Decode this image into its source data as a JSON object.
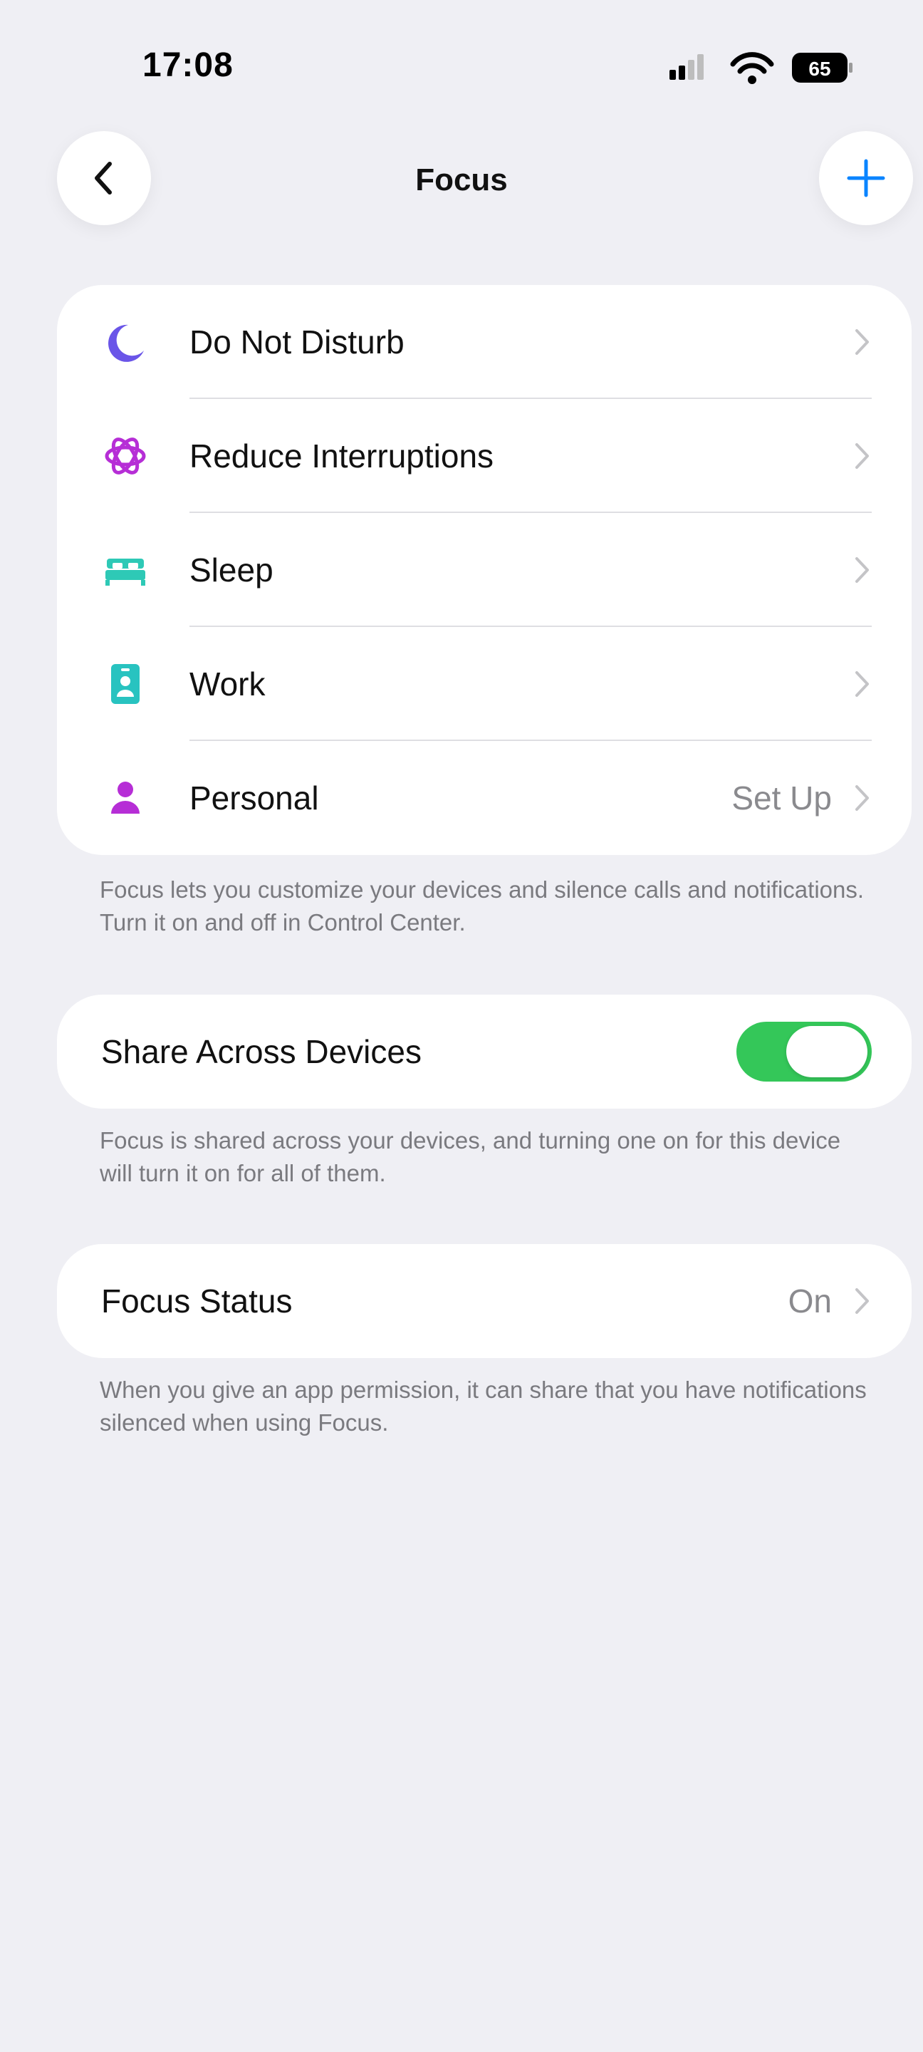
{
  "status_bar": {
    "time": "17:08",
    "battery_level": "65"
  },
  "nav": {
    "title": "Focus",
    "back_icon": "chevron-left-icon",
    "add_icon": "plus-icon"
  },
  "focus_modes": [
    {
      "label": "Do Not Disturb",
      "value": "",
      "icon": "moon-icon",
      "color": "#6a55e8"
    },
    {
      "label": "Reduce Interruptions",
      "value": "",
      "icon": "flower-icon",
      "color": "#b62ed6"
    },
    {
      "label": "Sleep",
      "value": "",
      "icon": "bed-icon",
      "color": "#2ec9b6"
    },
    {
      "label": "Work",
      "value": "",
      "icon": "badge-icon",
      "color": "#28c3c0"
    },
    {
      "label": "Personal",
      "value": "Set Up",
      "icon": "person-icon",
      "color": "#b62ed6"
    }
  ],
  "modes_footnote": "Focus lets you customize your devices and silence calls and notifications. Turn it on and off in Control Center.",
  "share_across_devices": {
    "label": "Share Across Devices",
    "enabled": true,
    "toggle_color": "#34c759"
  },
  "share_footnote": "Focus is shared across your devices, and turning one on for this device will turn it on for all of them.",
  "focus_status": {
    "label": "Focus Status",
    "value": "On"
  },
  "status_footnote": "When you give an app permission, it can share that you have notifications silenced when using Focus.",
  "colors": {
    "background": "#efeff4",
    "accent": "#0a84ff",
    "secondary_text": "#8a8a8e"
  }
}
